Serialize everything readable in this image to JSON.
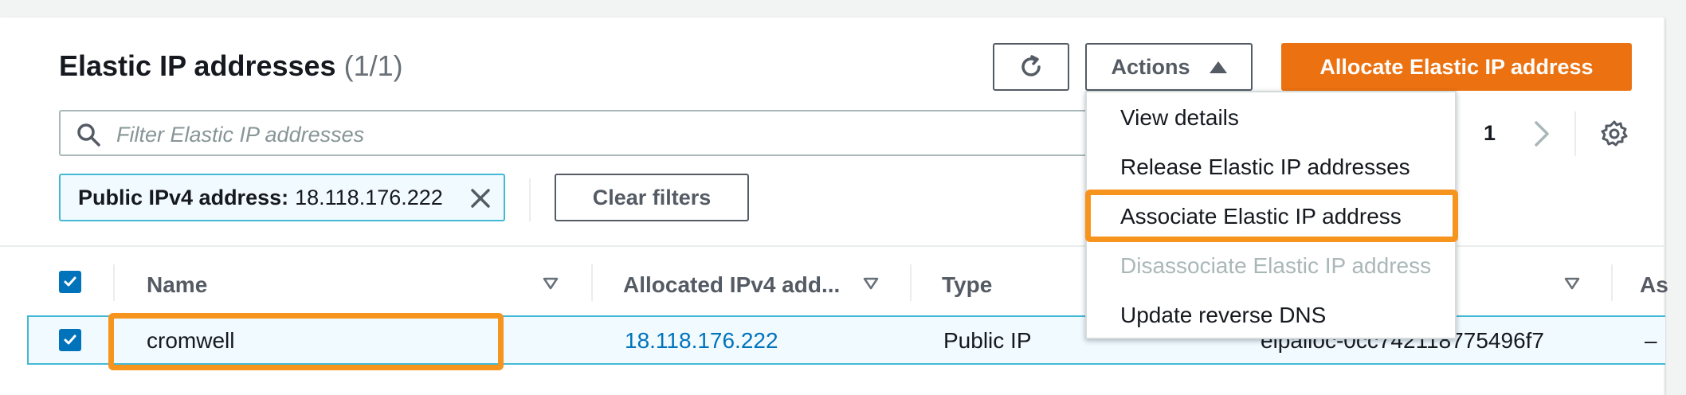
{
  "header": {
    "title": "Elastic IP addresses",
    "count": "(1/1)",
    "actions_label": "Actions",
    "allocate_label": "Allocate Elastic IP address"
  },
  "search": {
    "placeholder": "Filter Elastic IP addresses"
  },
  "pagination": {
    "current_page": "1"
  },
  "filter_token": {
    "key": "Public IPv4 address:",
    "value": "18.118.176.222"
  },
  "clear_filters_label": "Clear filters",
  "table": {
    "columns": [
      "Name",
      "Allocated IPv4 add...",
      "Type",
      "As"
    ],
    "rows": [
      {
        "name": "cromwell",
        "ip": "18.118.176.222",
        "type": "Public IP",
        "allocation_id": "eipalloc-0cc742118775496f7",
        "extra": "–"
      }
    ]
  },
  "actions_menu": {
    "items": [
      {
        "label": "View details",
        "disabled": false
      },
      {
        "label": "Release Elastic IP addresses",
        "disabled": false
      },
      {
        "label": "Associate Elastic IP address",
        "disabled": false,
        "highlighted": true
      },
      {
        "label": "Disassociate Elastic IP address",
        "disabled": true
      },
      {
        "label": "Update reverse DNS",
        "disabled": false
      }
    ]
  },
  "colors": {
    "accent_orange": "#ec7211",
    "highlight_orange": "#f7941e",
    "selection_blue": "#0073bb",
    "link_blue": "#0073bb"
  },
  "icons": [
    "refresh-icon",
    "caret-up-icon",
    "search-icon",
    "chevron-right-icon",
    "gear-icon",
    "close-icon",
    "sort-icon",
    "checkbox-checked-icon"
  ]
}
